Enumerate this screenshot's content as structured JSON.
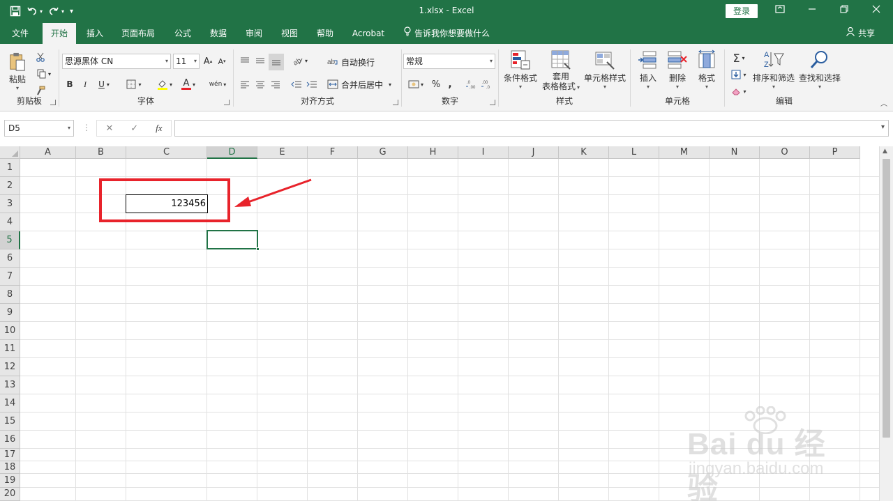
{
  "titlebar": {
    "title": "1.xlsx  -  Excel",
    "login_label": "登录"
  },
  "tabs": [
    {
      "label": "文件"
    },
    {
      "label": "开始"
    },
    {
      "label": "插入"
    },
    {
      "label": "页面布局"
    },
    {
      "label": "公式"
    },
    {
      "label": "数据"
    },
    {
      "label": "审阅"
    },
    {
      "label": "视图"
    },
    {
      "label": "帮助"
    },
    {
      "label": "Acrobat"
    }
  ],
  "tell_me": "告诉我你想要做什么",
  "share_label": "共享",
  "ribbon": {
    "clipboard": {
      "paste_label": "粘贴",
      "group_label": "剪贴板"
    },
    "font": {
      "font_name": "思源黑体 CN",
      "font_size": "11",
      "bold": "B",
      "italic": "I",
      "underline": "U",
      "grow": "A",
      "shrink": "A",
      "font_color_glyph": "A",
      "phonetic_glyph": "wén",
      "group_label": "字体"
    },
    "alignment": {
      "wrap_text": "自动换行",
      "merge_center": "合并后居中",
      "group_label": "对齐方式"
    },
    "number": {
      "format": "常规",
      "percent": "%",
      "comma": ",",
      "group_label": "数字"
    },
    "styles": {
      "conditional_format": "条件格式",
      "format_as_table_1": "套用",
      "format_as_table_2": "表格格式",
      "cell_styles": "单元格样式",
      "group_label": "样式"
    },
    "cells": {
      "insert": "插入",
      "delete": "删除",
      "format": "格式",
      "group_label": "单元格"
    },
    "editing": {
      "sort_filter": "排序和筛选",
      "find_select": "查找和选择",
      "group_label": "编辑"
    }
  },
  "formula_bar": {
    "name_box": "D5",
    "formula": ""
  },
  "grid": {
    "columns": [
      "A",
      "B",
      "C",
      "D",
      "E",
      "F",
      "G",
      "H",
      "I",
      "J",
      "K",
      "L",
      "M",
      "N",
      "O",
      "P"
    ],
    "rows": [
      "1",
      "2",
      "3",
      "4",
      "5",
      "6",
      "7",
      "8",
      "9",
      "10",
      "11",
      "12",
      "13",
      "14",
      "15",
      "16",
      "17",
      "18",
      "19",
      "20"
    ],
    "cell_c3_value": "123456",
    "selected_cell": "D5"
  },
  "watermark": {
    "brand": "Bai du 经验",
    "url": "jingyan.baidu.com"
  },
  "colors": {
    "excel_green": "#217346",
    "annotation_red": "#e8232b"
  }
}
